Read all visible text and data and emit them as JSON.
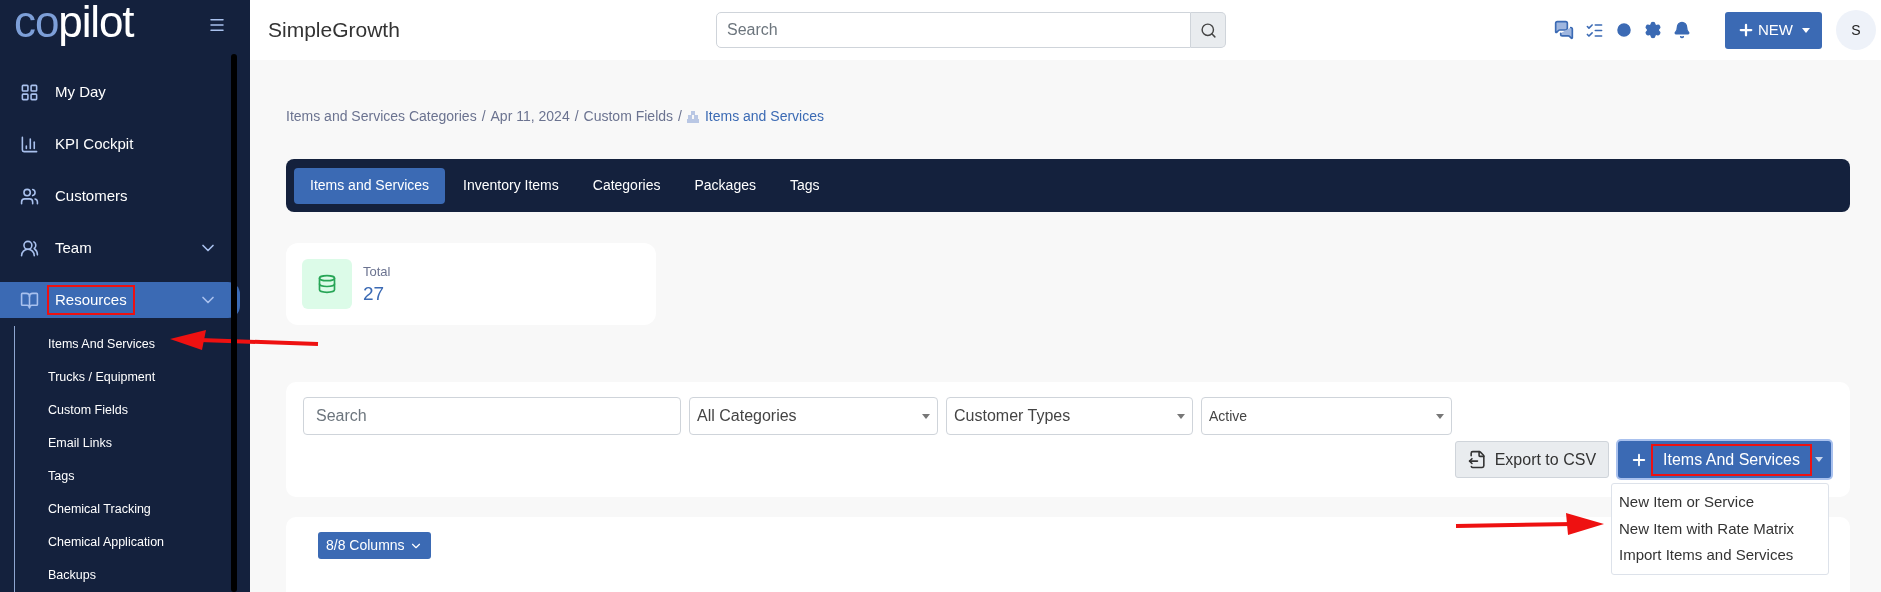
{
  "sidebar": {
    "logo": [
      "co",
      "pilot"
    ],
    "items": [
      {
        "label": "My Day",
        "selected": false,
        "expandable": false,
        "highlighted": false
      },
      {
        "label": "KPI Cockpit",
        "selected": false,
        "expandable": false,
        "highlighted": false
      },
      {
        "label": "Customers",
        "selected": false,
        "expandable": false,
        "highlighted": false
      },
      {
        "label": "Team",
        "selected": false,
        "expandable": true,
        "highlighted": false
      },
      {
        "label": "Resources",
        "selected": true,
        "expandable": true,
        "highlighted": true,
        "children": [
          {
            "label": "Items And Services",
            "pointed": true
          },
          {
            "label": "Trucks / Equipment",
            "pointed": false
          },
          {
            "label": "Custom Fields",
            "pointed": false
          },
          {
            "label": "Email Links",
            "pointed": false
          },
          {
            "label": "Tags",
            "pointed": false
          },
          {
            "label": "Chemical Tracking",
            "pointed": false
          },
          {
            "label": "Chemical Application",
            "pointed": false
          },
          {
            "label": "Backups",
            "pointed": false
          }
        ]
      }
    ]
  },
  "header": {
    "title": "SimpleGrowth",
    "search": {
      "placeholder": "Search"
    },
    "new_button": "NEW",
    "avatar": "S"
  },
  "breadcrumb_separator": "/",
  "breadcrumb": [
    {
      "label": "Items and Services Categories",
      "current": false
    },
    {
      "label": "Apr 11, 2024",
      "current": false
    },
    {
      "label": "Custom Fields",
      "current": false
    },
    {
      "label": "Items and Services",
      "current": true
    }
  ],
  "tabs": [
    {
      "label": "Items and Services",
      "selected": true
    },
    {
      "label": "Inventory Items",
      "selected": false
    },
    {
      "label": "Categories",
      "selected": false
    },
    {
      "label": "Packages",
      "selected": false
    },
    {
      "label": "Tags",
      "selected": false
    }
  ],
  "total": {
    "label": "Total",
    "value": "27"
  },
  "filters": {
    "search": {
      "placeholder": "Search"
    },
    "selects": [
      "All Categories",
      "Customer Types",
      "Active"
    ]
  },
  "export_button": "Export to CSV",
  "add_button": {
    "label": "Items And Services",
    "highlighted": true,
    "expanded": true
  },
  "add_menu": [
    {
      "label": "New Item or Service",
      "pointed": false
    },
    {
      "label": "New Item with Rate Matrix",
      "pointed": true
    },
    {
      "label": "Import Items and Services",
      "pointed": false
    }
  ],
  "columns_button": "8/8 Columns"
}
